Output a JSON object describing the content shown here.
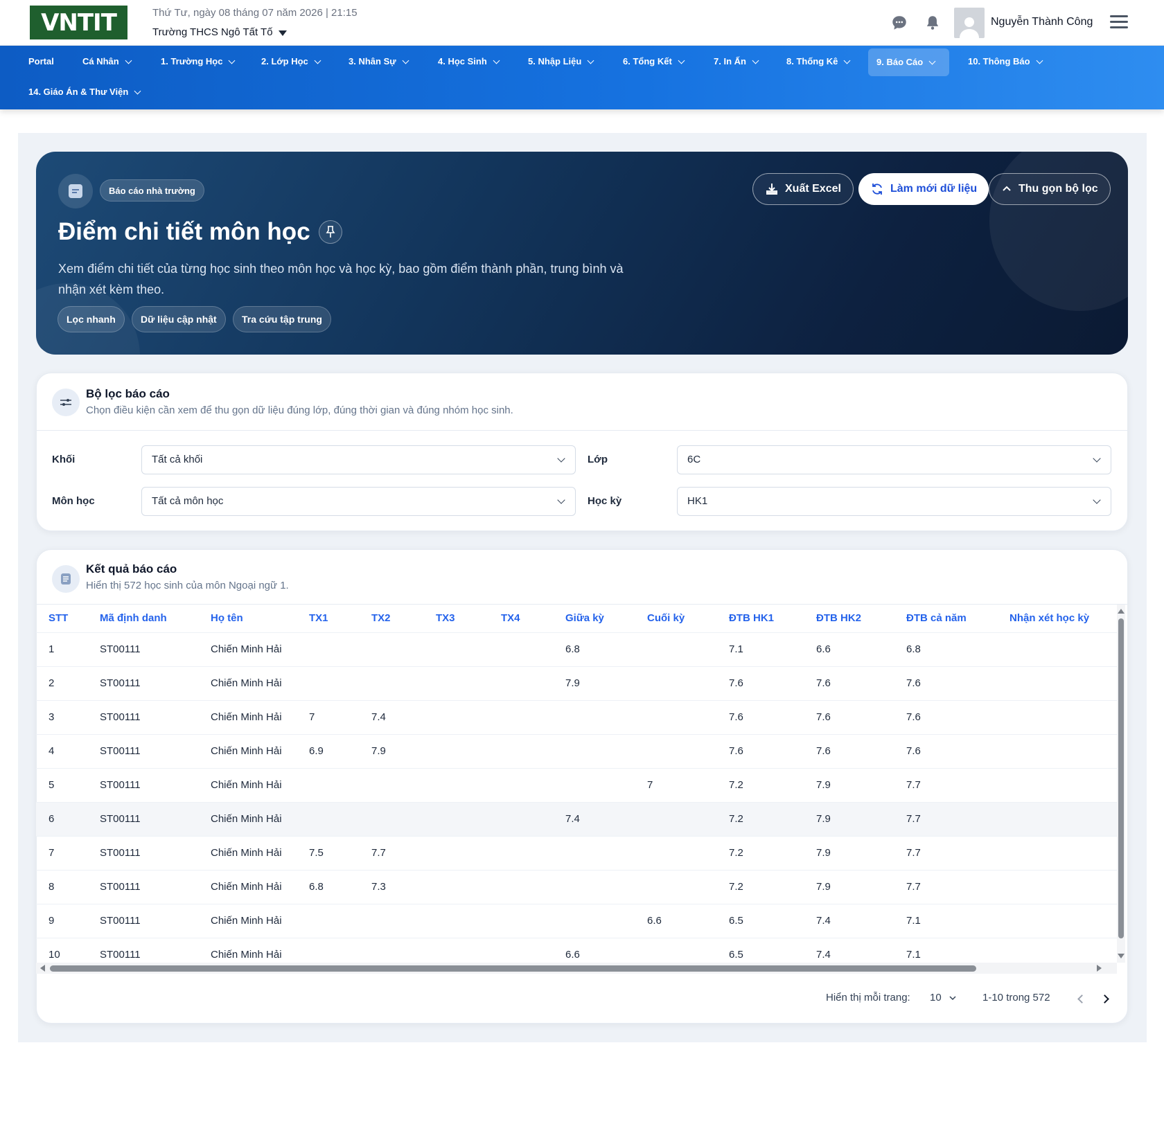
{
  "header": {
    "logo_text": "VNTIT",
    "datetime": "Thứ Tư, ngày 08 tháng 07 năm 2026 | 21:15",
    "school": "Trường THCS Ngô Tất Tố",
    "username": "Nguyễn Thành Công"
  },
  "nav": {
    "items": [
      "Portal",
      "Cá Nhân",
      "1. Trường Học",
      "2. Lớp Học",
      "3. Nhân Sự",
      "4. Học Sinh",
      "5. Nhập Liệu",
      "6. Tổng Kết",
      "7. In Ấn",
      "8. Thống Kê",
      "9. Báo Cáo",
      "10. Thông Báo",
      "14. Giáo Án & Thư Viện"
    ],
    "active": "9. Báo Cáo"
  },
  "hero": {
    "badge": "Báo cáo nhà trường",
    "title": "Điểm chi tiết môn học",
    "description": "Xem điểm chi tiết của từng học sinh theo môn học và học kỳ, bao gồm điểm thành phần, trung bình và nhận xét kèm theo.",
    "chips": [
      "Lọc nhanh",
      "Dữ liệu cập nhật",
      "Tra cứu tập trung"
    ],
    "buttons": {
      "export": "Xuất Excel",
      "refresh": "Làm mới dữ liệu",
      "collapse": "Thu gọn bộ lọc"
    }
  },
  "filters": {
    "title": "Bộ lọc báo cáo",
    "subtitle": "Chọn điều kiện cần xem để thu gọn dữ liệu đúng lớp, đúng thời gian và đúng nhóm học sinh.",
    "grade_label": "Khối",
    "grade_value": "Tất cả khối",
    "class_label": "Lớp",
    "class_value": "6C",
    "subject_label": "Môn học",
    "subject_value": "Tất cả môn học",
    "term_label": "Học kỳ",
    "term_value": "HK1"
  },
  "results": {
    "title": "Kết quả báo cáo",
    "subtitle": "Hiển thị 572 học sinh của môn Ngoại ngữ 1.",
    "columns": [
      "STT",
      "Mã định danh",
      "Họ tên",
      "TX1",
      "TX2",
      "TX3",
      "TX4",
      "Giữa kỳ",
      "Cuối kỳ",
      "ĐTB HK1",
      "ĐTB HK2",
      "ĐTB cả năm",
      "Nhận xét học kỳ"
    ],
    "rows": [
      [
        "1",
        "ST00111",
        "Chiến Minh Hải",
        "",
        "",
        "",
        "",
        "6.8",
        "",
        "7.1",
        "6.6",
        "6.8",
        ""
      ],
      [
        "2",
        "ST00111",
        "Chiến Minh Hải",
        "",
        "",
        "",
        "",
        "7.9",
        "",
        "7.6",
        "7.6",
        "7.6",
        ""
      ],
      [
        "3",
        "ST00111",
        "Chiến Minh Hải",
        "7",
        "7.4",
        "",
        "",
        "",
        "",
        "7.6",
        "7.6",
        "7.6",
        ""
      ],
      [
        "4",
        "ST00111",
        "Chiến Minh Hải",
        "6.9",
        "7.9",
        "",
        "",
        "",
        "",
        "7.6",
        "7.6",
        "7.6",
        ""
      ],
      [
        "5",
        "ST00111",
        "Chiến Minh Hải",
        "",
        "",
        "",
        "",
        "",
        "7",
        "7.2",
        "7.9",
        "7.7",
        ""
      ],
      [
        "6",
        "ST00111",
        "Chiến Minh Hải",
        "",
        "",
        "",
        "",
        "7.4",
        "",
        "7.2",
        "7.9",
        "7.7",
        ""
      ],
      [
        "7",
        "ST00111",
        "Chiến Minh Hải",
        "7.5",
        "7.7",
        "",
        "",
        "",
        "",
        "7.2",
        "7.9",
        "7.7",
        ""
      ],
      [
        "8",
        "ST00111",
        "Chiến Minh Hải",
        "6.8",
        "7.3",
        "",
        "",
        "",
        "",
        "7.2",
        "7.9",
        "7.7",
        ""
      ],
      [
        "9",
        "ST00111",
        "Chiến Minh Hải",
        "",
        "",
        "",
        "",
        "",
        "6.6",
        "6.5",
        "7.4",
        "7.1",
        ""
      ],
      [
        "10",
        "ST00111",
        "Chiến Minh Hải",
        "",
        "",
        "",
        "",
        "6.6",
        "",
        "6.5",
        "7.4",
        "7.1",
        ""
      ]
    ],
    "highlighted_row": 6
  },
  "pagination": {
    "per_page_label": "Hiển thị mỗi trang:",
    "per_page_value": "10",
    "range": "1-10 trong 572"
  },
  "colors": {
    "nav_gradient_start": "#0d5cc4",
    "nav_gradient_end": "#2e8df0",
    "hero_dark": "#0d2140",
    "accent_blue": "#2563eb",
    "logo_green": "#1f5f2e"
  }
}
